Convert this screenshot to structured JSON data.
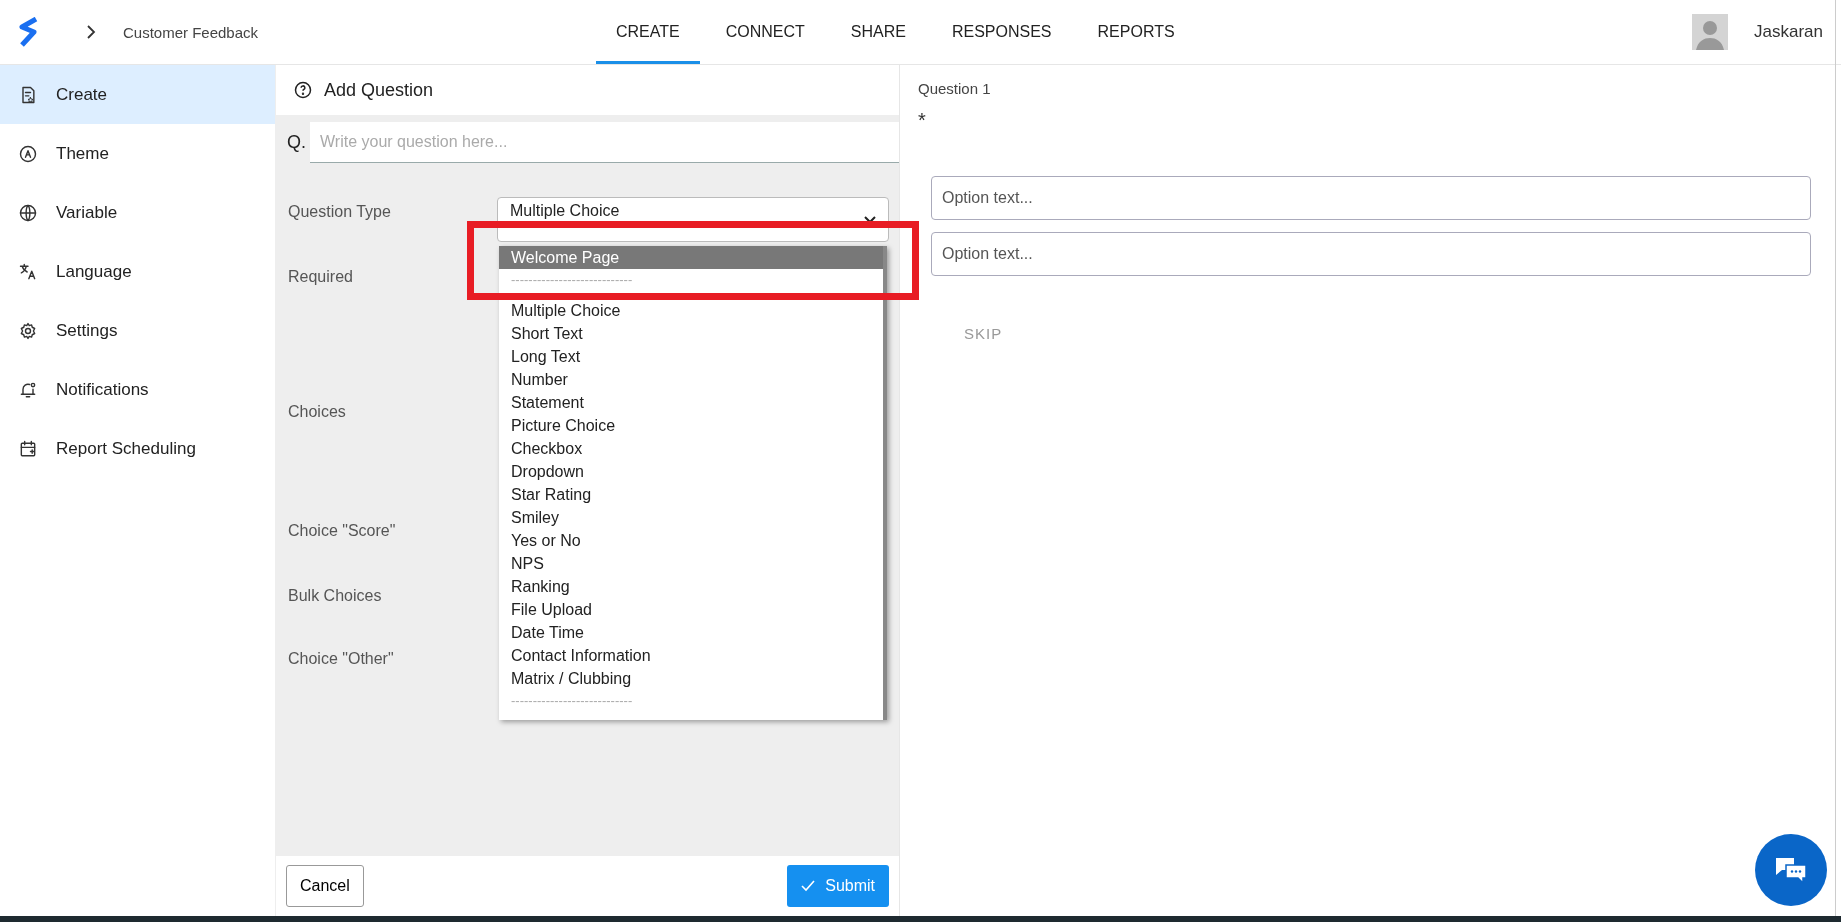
{
  "header": {
    "breadcrumb": "Customer Feedback",
    "user_name": "Jaskaran"
  },
  "tabs": [
    {
      "label": "CREATE",
      "selected": true
    },
    {
      "label": "CONNECT",
      "selected": false
    },
    {
      "label": "SHARE",
      "selected": false
    },
    {
      "label": "RESPONSES",
      "selected": false
    },
    {
      "label": "REPORTS",
      "selected": false
    }
  ],
  "sidebar": {
    "items": [
      {
        "label": "Create",
        "selected": true
      },
      {
        "label": "Theme",
        "selected": false
      },
      {
        "label": "Variable",
        "selected": false
      },
      {
        "label": "Language",
        "selected": false
      },
      {
        "label": "Settings",
        "selected": false
      },
      {
        "label": "Notifications",
        "selected": false
      },
      {
        "label": "Report Scheduling",
        "selected": false
      }
    ]
  },
  "editor": {
    "title": "Add Question",
    "question_prefix": "Q.",
    "question_placeholder": "Write your question here...",
    "labels": [
      "Question Type",
      "Required",
      "Choices",
      "Choice \"Score\"",
      "Bulk Choices",
      "Choice \"Other\""
    ],
    "question_type": "Multiple Choice",
    "dropdown_options": [
      {
        "label": "Welcome Page",
        "kind": "option",
        "selected": true
      },
      {
        "label": "----------------------------",
        "kind": "separator"
      },
      {
        "label": "Multiple Choice",
        "kind": "option",
        "selected": false
      },
      {
        "label": "Short Text",
        "kind": "option",
        "selected": false
      },
      {
        "label": "Long Text",
        "kind": "option",
        "selected": false
      },
      {
        "label": "Number",
        "kind": "option",
        "selected": false
      },
      {
        "label": "Statement",
        "kind": "option",
        "selected": false
      },
      {
        "label": "Picture Choice",
        "kind": "option",
        "selected": false
      },
      {
        "label": "Checkbox",
        "kind": "option",
        "selected": false
      },
      {
        "label": "Dropdown",
        "kind": "option",
        "selected": false
      },
      {
        "label": "Star Rating",
        "kind": "option",
        "selected": false
      },
      {
        "label": "Smiley",
        "kind": "option",
        "selected": false
      },
      {
        "label": "Yes or No",
        "kind": "option",
        "selected": false
      },
      {
        "label": "NPS",
        "kind": "option",
        "selected": false
      },
      {
        "label": "Ranking",
        "kind": "option",
        "selected": false
      },
      {
        "label": "File Upload",
        "kind": "option",
        "selected": false
      },
      {
        "label": "Date Time",
        "kind": "option",
        "selected": false
      },
      {
        "label": "Contact Information",
        "kind": "option",
        "selected": false
      },
      {
        "label": "Matrix / Clubbing",
        "kind": "option",
        "selected": false
      },
      {
        "label": "----------------------------",
        "kind": "separator"
      }
    ],
    "cancel": "Cancel",
    "submit": "Submit"
  },
  "preview": {
    "title": "Question 1",
    "required_mark": "*",
    "option_placeholders": [
      "Option text...",
      "Option text..."
    ],
    "skip": "SKIP"
  }
}
